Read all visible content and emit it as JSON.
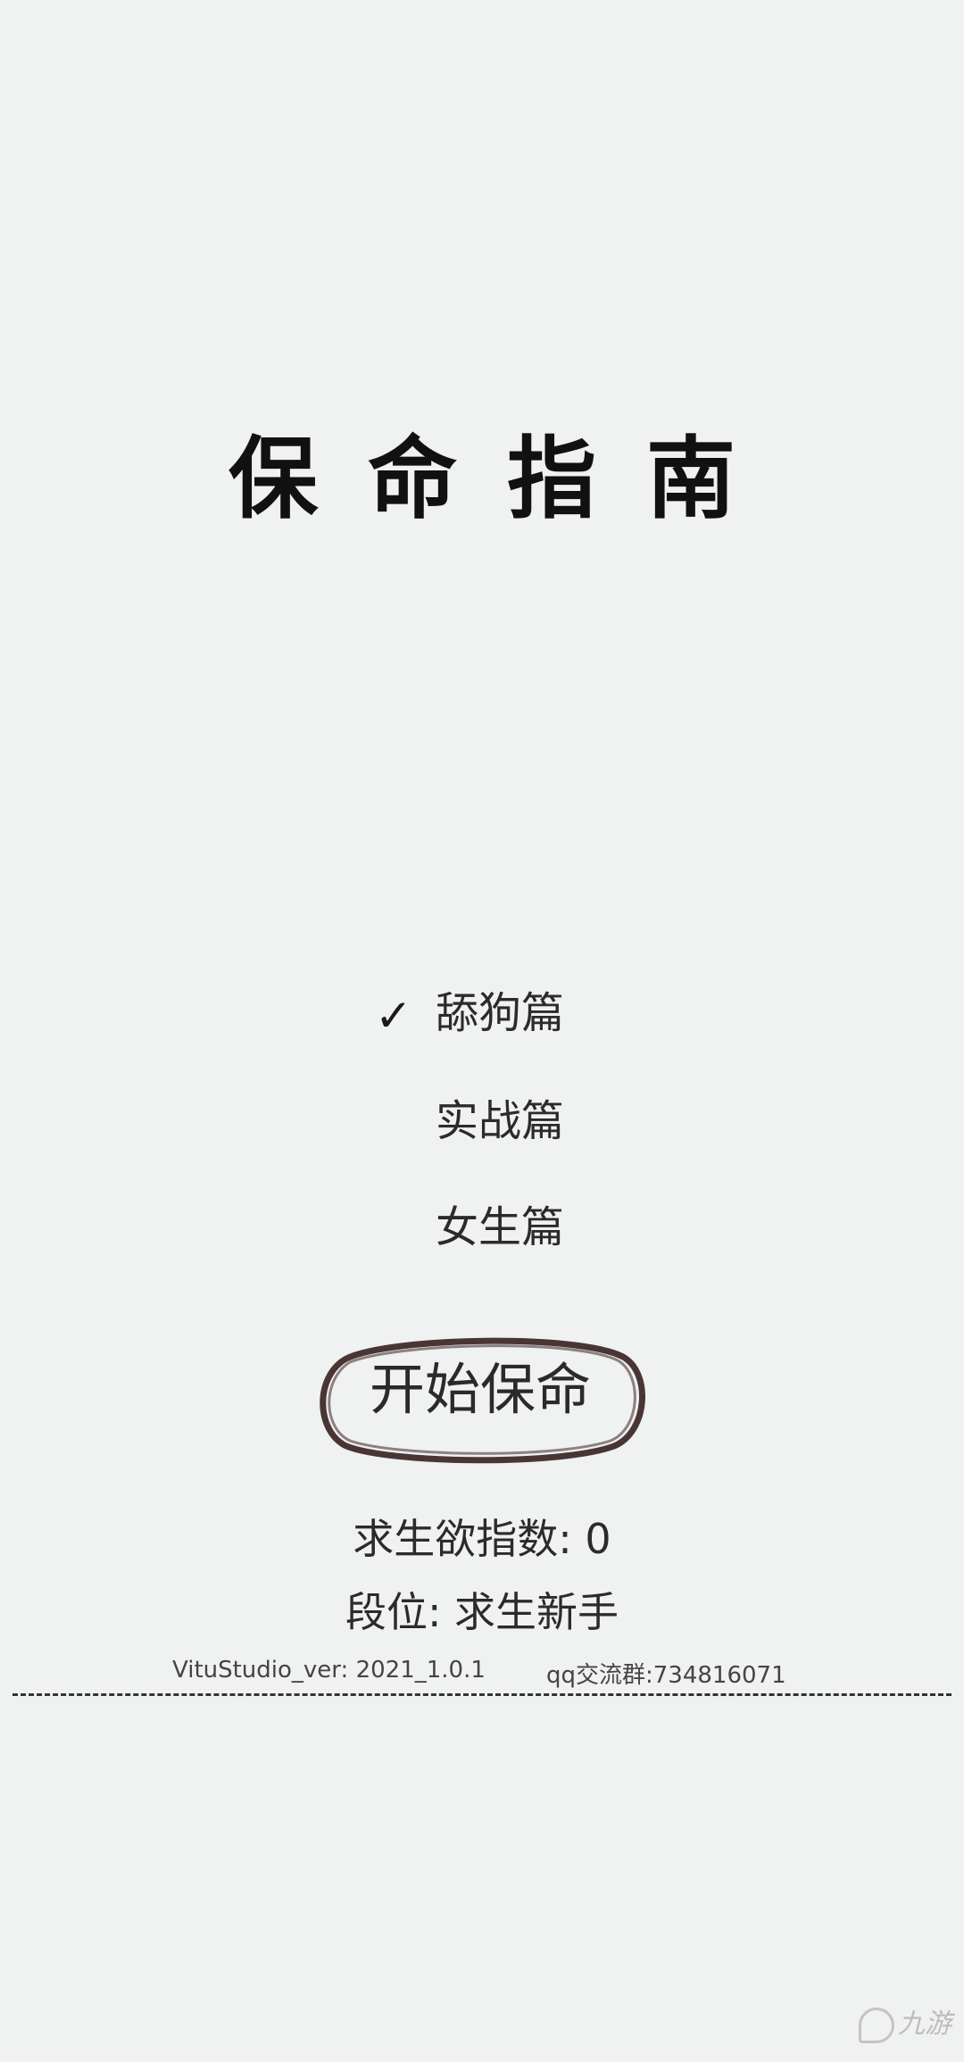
{
  "title": "保命指南",
  "menu": {
    "items": [
      {
        "label": "舔狗篇",
        "selected": true
      },
      {
        "label": "实战篇",
        "selected": false
      },
      {
        "label": "女生篇",
        "selected": false
      }
    ],
    "check_glyph": "✓"
  },
  "start_button": {
    "label": "开始保命",
    "ring_color": "#4a3535"
  },
  "stats": {
    "survival_index": "求生欲指数: 0",
    "rank": "段位: 求生新手"
  },
  "footer": {
    "version": "VituStudio_ver: 2021_1.0.1",
    "qq_group": "qq交流群:734816071"
  },
  "watermark": {
    "text": "九游",
    "icon": "jiuyou-logo-icon"
  },
  "colors": {
    "background": "#f0f1f1",
    "text": "#2a2a2a"
  }
}
